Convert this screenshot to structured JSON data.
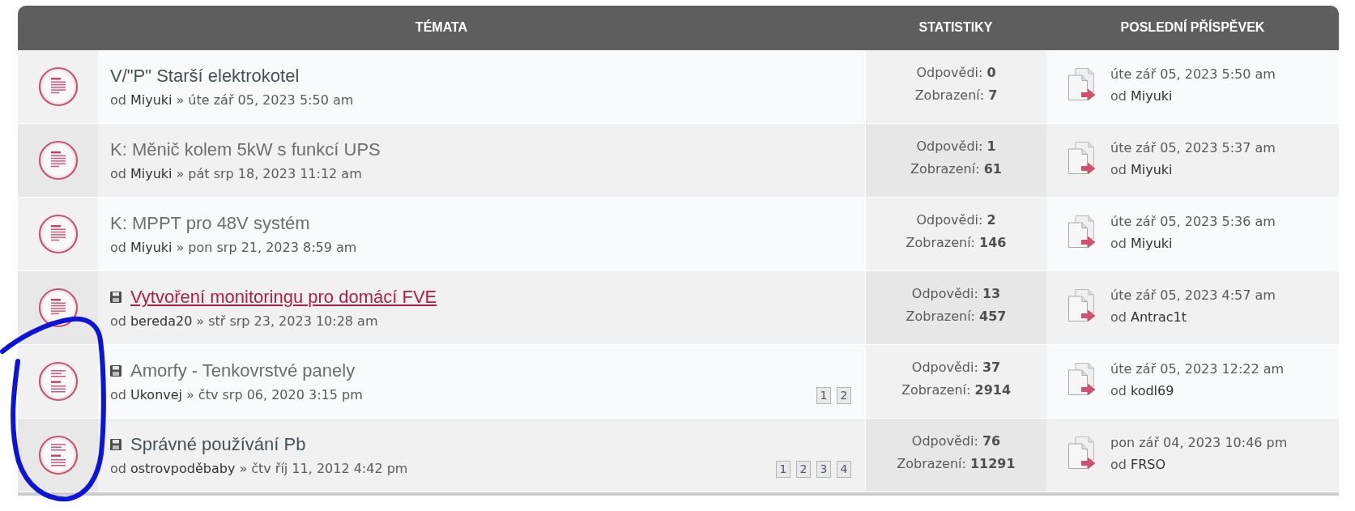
{
  "table": {
    "columns": [
      {
        "label": "TÉMATA"
      },
      {
        "label": "STATISTIKY"
      },
      {
        "label": "POSLEDNÍ PŘÍSPĚVEK"
      }
    ],
    "topics": [
      {
        "title": "V/\"P\" Starší elektrokotel",
        "visited": false,
        "hovered": false,
        "attachment": false,
        "hot": false,
        "by": "od",
        "author": "Miyuki",
        "separator": "»",
        "date": "úte zář 05, 2023 5:50 am",
        "replies": "Odpovědi: **0**",
        "views": "Zobrazení: **7**",
        "last_post": {
          "date": "úte zář 05, 2023 5:50 am",
          "by": "od",
          "author": "Miyuki"
        }
      },
      {
        "title": "K: Měnič kolem 5kW s funkcí UPS",
        "visited": true,
        "hovered": false,
        "attachment": false,
        "hot": false,
        "by": "od",
        "author": "Miyuki",
        "separator": "»",
        "date": "pát srp 18, 2023 11:12 am",
        "replies": "Odpovědi: **1**",
        "views": "Zobrazení: **61**",
        "last_post": {
          "date": "úte zář 05, 2023 5:37 am",
          "by": "od",
          "author": "Miyuki"
        }
      },
      {
        "title": "K: MPPT pro 48V systém",
        "visited": true,
        "hovered": false,
        "attachment": false,
        "hot": false,
        "by": "od",
        "author": "Miyuki",
        "separator": "»",
        "date": "pon srp 21, 2023 8:59 am",
        "replies": "Odpovědi: **2**",
        "views": "Zobrazení: **146**",
        "last_post": {
          "date": "úte zář 05, 2023 5:36 am",
          "by": "od",
          "author": "Miyuki"
        }
      },
      {
        "title": "Vytvoření monitoringu pro domácí FVE",
        "visited": false,
        "hovered": true,
        "attachment": true,
        "hot": false,
        "by": "od",
        "author": "bereda20",
        "separator": "»",
        "date": "stř srp 23, 2023 10:28 am",
        "replies": "Odpovědi: **13**",
        "views": "Zobrazení: **457**",
        "last_post": {
          "date": "úte zář 05, 2023 4:57 am",
          "by": "od",
          "author": "Antrac1t"
        }
      },
      {
        "title": "Amorfy - Tenkovrstvé panely",
        "visited": true,
        "hovered": false,
        "attachment": true,
        "hot": true,
        "by": "od",
        "author": "Ukonvej",
        "separator": "»",
        "date": "čtv srp 06, 2020 3:15 pm",
        "pages": [
          "1",
          "2"
        ],
        "replies": "Odpovědi: **37**",
        "views": "Zobrazení: **2914**",
        "last_post": {
          "date": "úte zář 05, 2023 12:22 am",
          "by": "od",
          "author": "kodl69"
        }
      },
      {
        "title": "Správné používání Pb",
        "visited": false,
        "hovered": false,
        "attachment": true,
        "hot": true,
        "by": "od",
        "author": "ostrovpoděbaby",
        "separator": "»",
        "date": "čtv říj 11, 2012 4:42 pm",
        "pages": [
          "1",
          "2",
          "3",
          "4"
        ],
        "replies": "Odpovědi: **76**",
        "views": "Zobrazení: **11291**",
        "last_post": {
          "date": "pon zář 04, 2023 10:46 pm",
          "by": "od",
          "author": "FRSO"
        }
      }
    ]
  }
}
